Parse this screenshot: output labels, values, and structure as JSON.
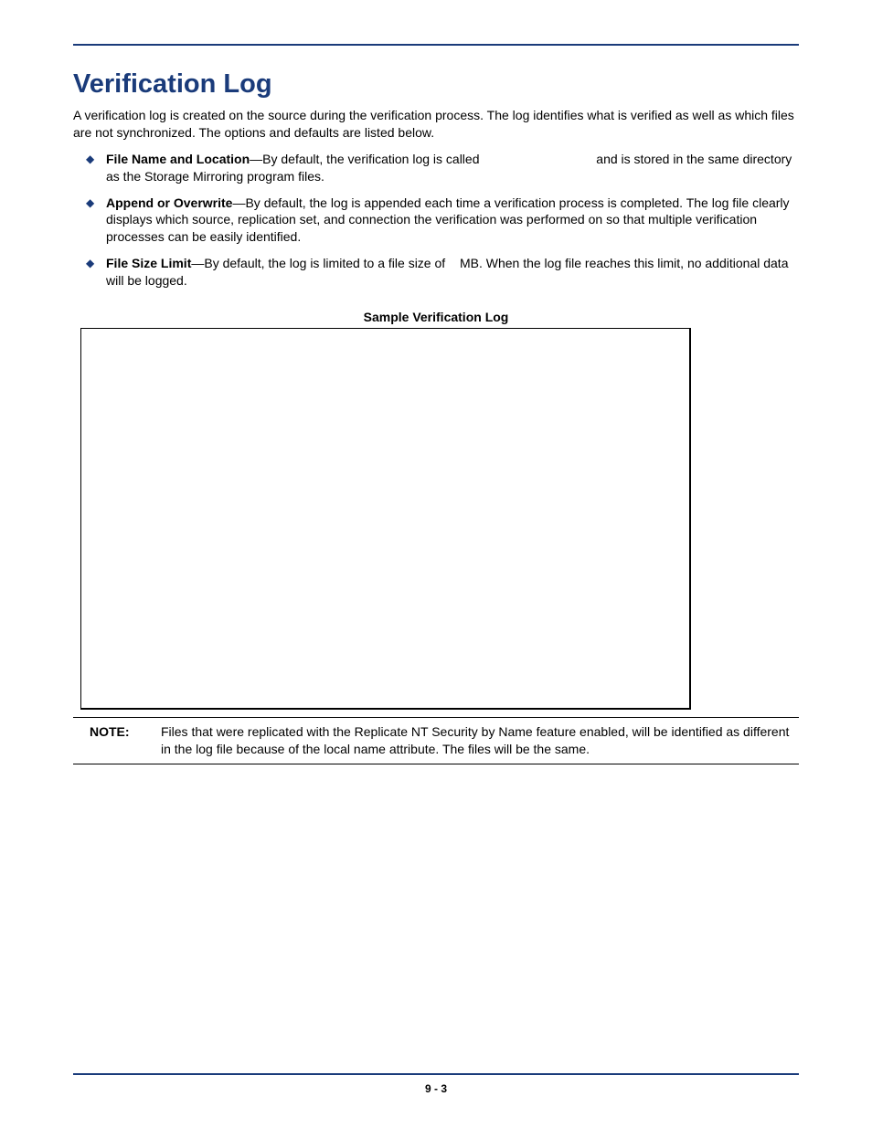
{
  "title": "Verification Log",
  "intro": "A verification log is created on the source during the verification process.  The log identifies what is verified as well as which files are not synchronized. The options and defaults are listed below.",
  "bullets": [
    {
      "label": "File Name and Location",
      "text_before": "—By default, the verification log is called ",
      "text_after": " and is stored in the same directory as the Storage Mirroring program files."
    },
    {
      "label": "Append or Overwrite",
      "text_before": "—By default, the log is appended each time a verification process is completed. The log file clearly displays which source, replication set, and connection the verification was performed on so that multiple verification processes can be easily identified.",
      "text_after": ""
    },
    {
      "label": "File Size Limit",
      "text_before": "—By default, the log is limited to a file size of ",
      "text_after": " MB. When the log file reaches this limit, no additional data will be logged."
    }
  ],
  "sample_caption": "Sample Verification Log",
  "note": {
    "label": "NOTE:",
    "body": "Files that were replicated with the Replicate NT Security by Name feature enabled, will be identified as different in the log file because of the local name attribute. The files will be the same."
  },
  "page_number": "9 - 3"
}
